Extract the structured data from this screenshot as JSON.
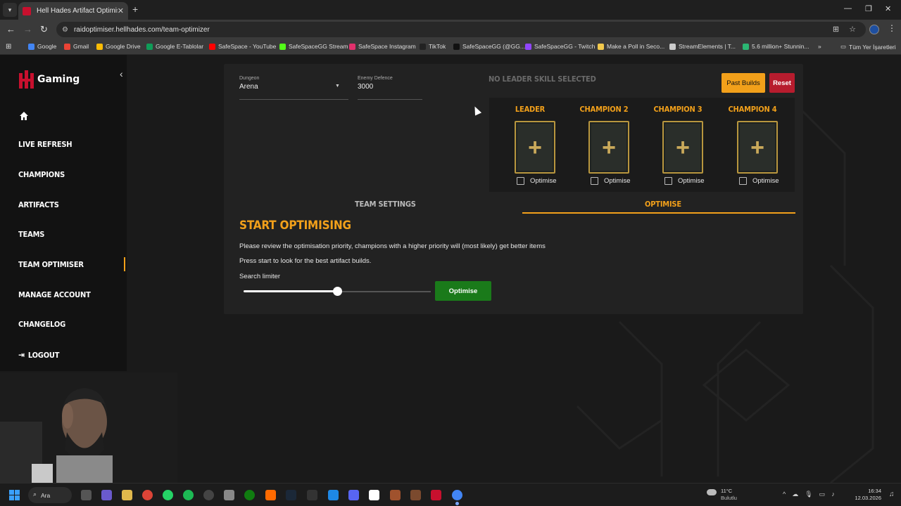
{
  "browser": {
    "tab_title": "Hell Hades Artifact Optimiser",
    "url": "raidoptimiser.hellhades.com/team-optimizer",
    "bookmarks": [
      {
        "label": "Google",
        "color": "#4285f4"
      },
      {
        "label": "Gmail",
        "color": "#ea4335"
      },
      {
        "label": "Google Drive",
        "color": "#fbbc05"
      },
      {
        "label": "Google E-Tablolar",
        "color": "#0f9d58"
      },
      {
        "label": "SafeSpace - YouTube",
        "color": "#ff0000"
      },
      {
        "label": "SafeSpaceGG Stream",
        "color": "#53fc18"
      },
      {
        "label": "SafeSpace Instagram",
        "color": "#e1306c"
      },
      {
        "label": "TikTok",
        "color": "#222222"
      },
      {
        "label": "SafeSpaceGG (@GG...",
        "color": "#111111"
      },
      {
        "label": "SafeSpaceGG - Twitch",
        "color": "#9146ff"
      },
      {
        "label": "Make a Poll in Seco...",
        "color": "#f2c94c"
      },
      {
        "label": "StreamElements | T...",
        "color": "#cccccc"
      },
      {
        "label": "5.6 million+ Stunnin...",
        "color": "#2bb673"
      }
    ],
    "all_bookmarks_label": "Tüm Yer İşaretleri"
  },
  "sidebar": {
    "logo_text": "Gaming",
    "items": [
      {
        "label": "Live Refresh"
      },
      {
        "label": "Champions"
      },
      {
        "label": "Artifacts"
      },
      {
        "label": "Teams"
      },
      {
        "label": "Team Optimiser"
      },
      {
        "label": "Manage Account"
      },
      {
        "label": "Changelog"
      },
      {
        "label": "Logout"
      }
    ],
    "active_item": "Team Optimiser"
  },
  "panel": {
    "dungeon_label": "Dungeon",
    "dungeon_value": "Arena",
    "enemy_defence_label": "Enemy Defence",
    "enemy_defence_value": "3000",
    "leader_skill_text": "No Leader Skill Selected",
    "past_builds_label": "Past Builds",
    "reset_label": "Reset",
    "slots": [
      {
        "name": "Leader",
        "checkbox_label": "Optimise"
      },
      {
        "name": "Champion 2",
        "checkbox_label": "Optimise"
      },
      {
        "name": "Champion 3",
        "checkbox_label": "Optimise"
      },
      {
        "name": "Champion 4",
        "checkbox_label": "Optimise"
      }
    ],
    "tabs": {
      "team_settings": "Team Settings",
      "optimise": "Optimise"
    },
    "active_tab": "Optimise",
    "start_title": "Start Optimising",
    "review_text": "Please review the optimisation priority, champions with a higher priority will (most likely) get better items",
    "press_text": "Press start to look for the best artifact builds.",
    "search_limiter_label": "Search limiter",
    "search_limiter_level": 0.5,
    "optimise_button": "Optimise"
  },
  "colors": {
    "accent": "#f2a01a",
    "danger": "#b71c2e",
    "success": "#1a7a1a",
    "brand": "#c8102e"
  },
  "taskbar": {
    "search_label": "Ara",
    "weather_temp": "11°C",
    "weather_cond": "Bulutlu",
    "time": "16:34",
    "date": "12.03.2026"
  }
}
